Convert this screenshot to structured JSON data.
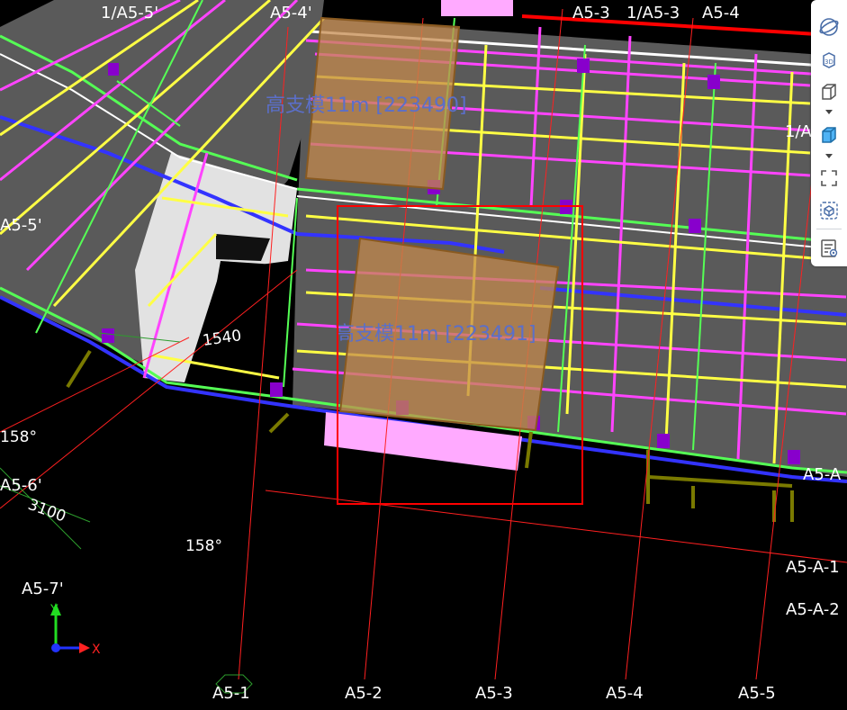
{
  "viewer": {
    "zones": [
      {
        "label": "高支模11m [223490]"
      },
      {
        "label": "高支模11m [223491]"
      }
    ],
    "grid_labels": {
      "top": [
        "1/A5-5'",
        "A5-4'",
        "A5-3",
        "1/A5-3",
        "A5-4"
      ],
      "bottom": [
        "A5-1",
        "A5-2",
        "A5-3",
        "A5-4",
        "A5-5"
      ],
      "left": [
        "A5-5'",
        "A5-6'",
        "A5-7'"
      ],
      "right": [
        "1/A",
        "A5-A",
        "A5-A-1",
        "A5-A-2"
      ]
    },
    "dimensions": {
      "angle_1": "158°",
      "angle_2": "158°",
      "length_1": "3100",
      "length_2": "1540"
    },
    "axes": {
      "x": "X",
      "y": "Y"
    }
  },
  "toolbar": {
    "items": [
      {
        "icon": "orbit-icon"
      },
      {
        "icon": "3d-view-icon"
      },
      {
        "icon": "box-view-icon"
      },
      {
        "icon": "cube-view-icon"
      },
      {
        "icon": "fit-screen-icon"
      },
      {
        "icon": "section-box-icon"
      },
      {
        "icon": "properties-icon"
      }
    ]
  },
  "colors": {
    "selection": "#ff0000",
    "zone_fill": "#c48a4e",
    "beam": "#ffff44",
    "rebar": "#ff44ff",
    "edge": "#55ff55",
    "column": "#8800cc",
    "wall": "#3333ff",
    "slab": "#5a5a5a"
  }
}
